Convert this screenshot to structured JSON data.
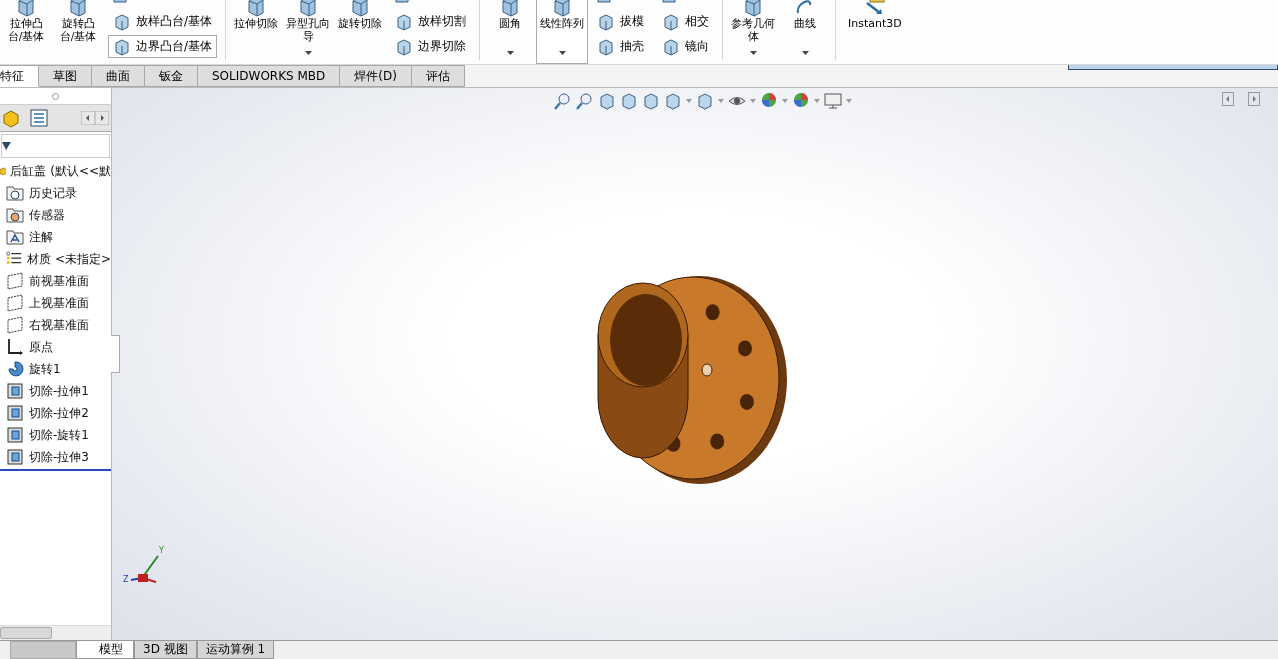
{
  "ribbon": [
    {
      "kind": "large",
      "label": "拉伸凸台/基体",
      "dropdown": false,
      "boxed": false
    },
    {
      "kind": "large",
      "label": "旋转凸台/基体",
      "dropdown": false,
      "boxed": false
    },
    {
      "kind": "stack",
      "items": [
        {
          "label": "放样凸台/基体",
          "boxed": false
        },
        {
          "label": "边界凸台/基体",
          "boxed": true
        }
      ]
    },
    {
      "kind": "separator"
    },
    {
      "kind": "large",
      "label": "拉伸切除",
      "dropdown": false,
      "boxed": false
    },
    {
      "kind": "large",
      "label": "异型孔向导",
      "dropdown": true,
      "boxed": false
    },
    {
      "kind": "large",
      "label": "旋转切除",
      "dropdown": false,
      "boxed": false
    },
    {
      "kind": "stack",
      "items": [
        {
          "label": "放样切割",
          "boxed": false
        },
        {
          "label": "边界切除",
          "boxed": false
        }
      ]
    },
    {
      "kind": "separator"
    },
    {
      "kind": "large",
      "label": "圆角",
      "dropdown": true,
      "boxed": false
    },
    {
      "kind": "large",
      "label": "线性阵列",
      "dropdown": true,
      "boxed": true
    },
    {
      "kind": "stack",
      "items": [
        {
          "label": "拔模",
          "boxed": false
        },
        {
          "label": "抽壳",
          "boxed": false
        }
      ]
    },
    {
      "kind": "stack",
      "items": [
        {
          "label": "相交",
          "boxed": false
        },
        {
          "label": "镜向",
          "boxed": false
        }
      ]
    },
    {
      "kind": "separator"
    },
    {
      "kind": "large",
      "label": "参考几何体",
      "dropdown": true,
      "boxed": false
    },
    {
      "kind": "large",
      "label": "曲线",
      "dropdown": true,
      "boxed": false
    },
    {
      "kind": "separator"
    },
    {
      "kind": "large",
      "label": "Instant3D",
      "dropdown": false,
      "boxed": false
    }
  ],
  "tabs": [
    {
      "label": "特征",
      "selected": true
    },
    {
      "label": "草图",
      "selected": false
    },
    {
      "label": "曲面",
      "selected": false
    },
    {
      "label": "钣金",
      "selected": false
    },
    {
      "label": "SOLIDWORKS MBD",
      "selected": false
    },
    {
      "label": "焊件(D)",
      "selected": false
    },
    {
      "label": "评估",
      "selected": false
    }
  ],
  "feature_tree": {
    "root": "后缸盖  (默认<<默",
    "items": [
      {
        "label": "历史记录",
        "kind": "history"
      },
      {
        "label": "传感器",
        "kind": "sensor"
      },
      {
        "label": "注解",
        "kind": "annotation"
      },
      {
        "label": "材质 <未指定>",
        "kind": "material"
      },
      {
        "label": "前视基准面",
        "kind": "plane"
      },
      {
        "label": "上视基准面",
        "kind": "plane"
      },
      {
        "label": "右视基准面",
        "kind": "plane"
      },
      {
        "label": "原点",
        "kind": "origin"
      },
      {
        "label": "旋转1",
        "kind": "revolve"
      },
      {
        "label": "切除-拉伸1",
        "kind": "cut"
      },
      {
        "label": "切除-拉伸2",
        "kind": "cut"
      },
      {
        "label": "切除-旋转1",
        "kind": "cutrevolve"
      },
      {
        "label": "切除-拉伸3",
        "kind": "cut"
      }
    ]
  },
  "triad": {
    "y_label": "Y",
    "z_label": "Z"
  },
  "bottom_tabs": [
    {
      "label": "模型",
      "selected": true
    },
    {
      "label": "3D 视图",
      "selected": false
    },
    {
      "label": "运动算例 1",
      "selected": false
    }
  ]
}
